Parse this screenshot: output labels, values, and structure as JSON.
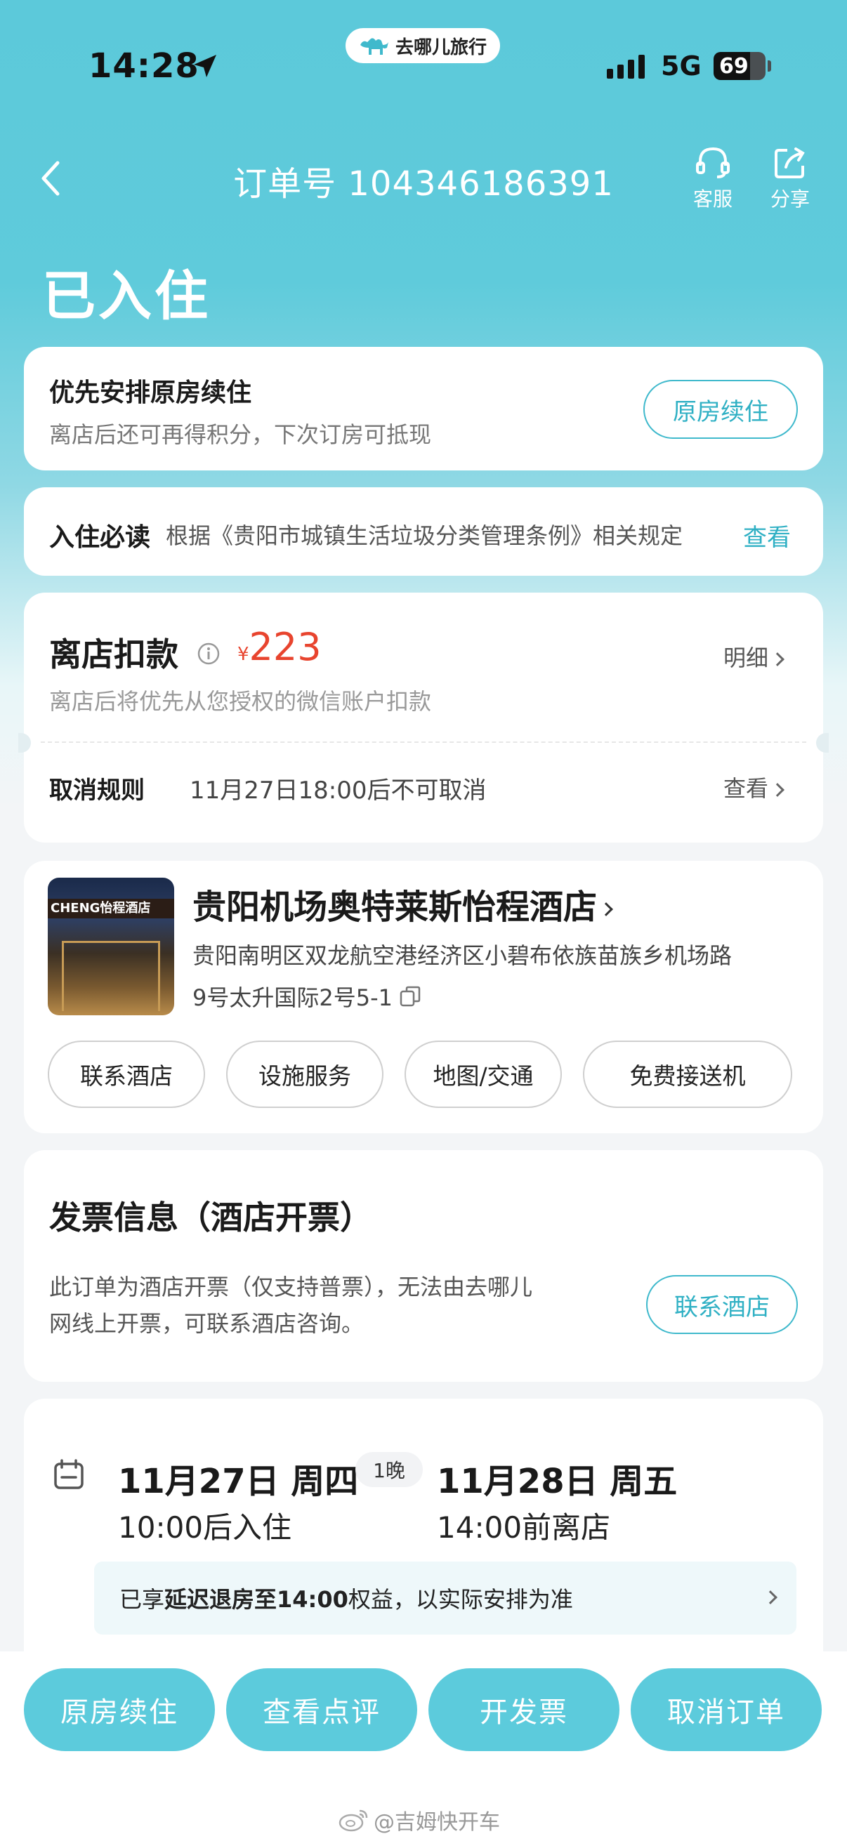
{
  "status_bar": {
    "time": "14:28",
    "network": "5G",
    "battery": "69",
    "battery_level": 0.69,
    "brand_pill": "去哪儿旅行"
  },
  "header": {
    "order_label": "订单号 104346186391",
    "actions": [
      {
        "label": "客服",
        "icon": "headset-icon"
      },
      {
        "label": "分享",
        "icon": "share-icon"
      }
    ],
    "status": "已入住"
  },
  "extend_card": {
    "title": "优先安排原房续住",
    "subtitle": "离店后还可再得积分，下次订房可抵现",
    "button": "原房续住"
  },
  "notice": {
    "label": "入住必读",
    "text": "根据《贵阳市城镇生活垃圾分类管理条例》相关规定",
    "link": "查看"
  },
  "payment": {
    "title": "离店扣款",
    "currency": "¥",
    "amount": "223",
    "desc": "离店后将优先从您授权的微信账户扣款",
    "detail_link": "明细",
    "cancel_label": "取消规则",
    "cancel_text": "11月27日18:00后不可取消",
    "cancel_link": "查看"
  },
  "hotel": {
    "name": "贵阳机场奥特莱斯怡程酒店",
    "address_line1": "贵阳南明区双龙航空港经济区小碧布依族苗族乡机场路",
    "address_line2": "9号太升国际2号5-1",
    "sign_text": "CHENG怡程酒店",
    "actions": [
      "联系酒店",
      "设施服务",
      "地图/交通",
      "免费接送机"
    ]
  },
  "invoice": {
    "title": "发票信息（酒店开票）",
    "desc_line1": "此订单为酒店开票（仅支持普票），无法由去哪儿",
    "desc_line2": "网线上开票，可联系酒店咨询。",
    "button": "联系酒店"
  },
  "stay": {
    "checkin_date": "11月27日 周四",
    "checkin_time": "10:00后入住",
    "nights": "1晚",
    "checkout_date": "11月28日 周五",
    "checkout_time": "14:00前离店",
    "benefit_prefix": "已享",
    "benefit_bold": "延迟退房至14:00",
    "benefit_suffix": "权益，以实际安排为准"
  },
  "bottom_buttons": [
    "原房续住",
    "查看点评",
    "开发票",
    "取消订单"
  ],
  "watermark": "@吉姆快开车",
  "colors": {
    "accent": "#5ccbdc",
    "price": "#e8442e",
    "outline": "#3fb9cc"
  }
}
